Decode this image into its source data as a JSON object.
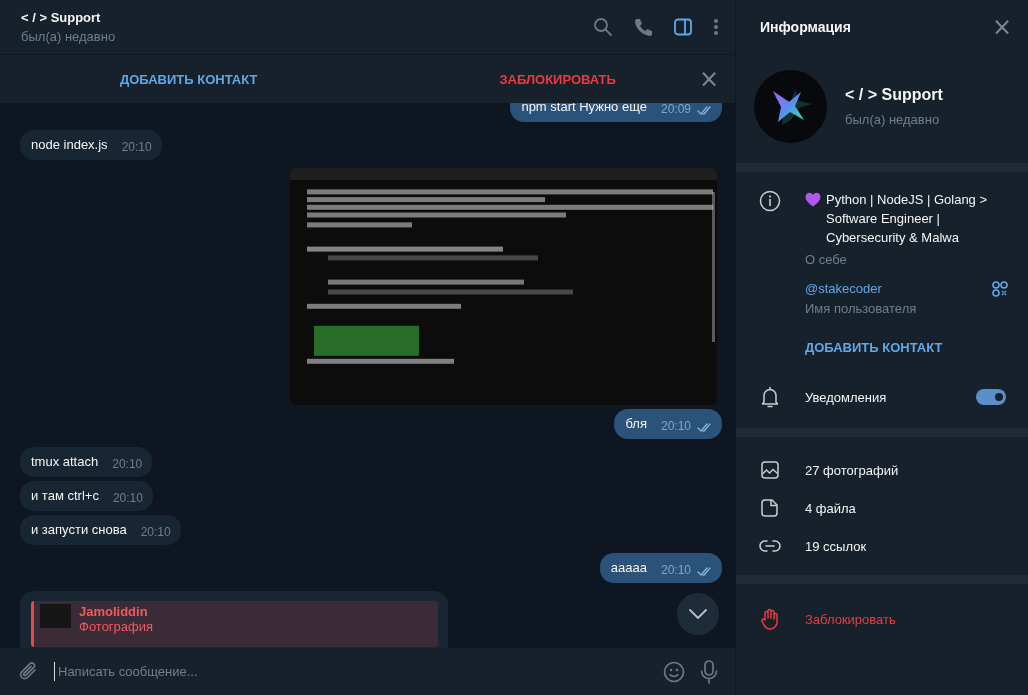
{
  "chat_header": {
    "title": "< / > Support",
    "status": "был(а) недавно",
    "icons": [
      {
        "kind": "search",
        "selected": false
      },
      {
        "kind": "phone",
        "selected": false
      },
      {
        "kind": "sidebar",
        "selected": true
      },
      {
        "kind": "more",
        "selected": false
      }
    ]
  },
  "action_bar": {
    "buttons": [
      {
        "kind": "add",
        "label": "ДОБАВИТЬ КОНТАКТ"
      },
      {
        "kind": "block",
        "label": "ЗАБЛОКИРОВАТЬ"
      }
    ],
    "close": "×"
  },
  "messages": [
    {
      "kind": "text",
      "outgoing": true,
      "text": "npm start Нужно еще",
      "time": "20:09",
      "read": true
    },
    {
      "kind": "text",
      "outgoing": false,
      "text": "node index.js",
      "time": "20:10"
    },
    {
      "kind": "picture",
      "outgoing": true
    },
    {
      "kind": "text",
      "outgoing": true,
      "text": "бля",
      "time": "20:10",
      "read": true
    },
    {
      "kind": "text",
      "outgoing": false,
      "text": "tmux attach",
      "time": "20:10"
    },
    {
      "kind": "text",
      "outgoing": false,
      "text": "и там ctrl+c",
      "time": "20:10"
    },
    {
      "kind": "text",
      "outgoing": false,
      "text": "и запусти снова",
      "time": "20:10"
    },
    {
      "kind": "text",
      "outgoing": true,
      "text": "ааааа",
      "time": "20:10",
      "read": true
    },
    {
      "kind": "reply",
      "outgoing": false,
      "reply": {
        "author": "Jamoliddin",
        "text": "Фотография"
      }
    }
  ],
  "composer": {
    "placeholder": "Написать сообщение..."
  },
  "info_panel": {
    "title": "Информация",
    "close": "×",
    "profile": {
      "name": "< / > Support",
      "status": "был(а) недавно"
    },
    "bio": {
      "text": "Python | NodeJS | Golang > Software Engineer | Cybersecurity & Malwa",
      "label": "О себе"
    },
    "username": {
      "value": "@stakecoder",
      "label": "Имя пользователя"
    },
    "add_contact": "ДОБАВИТЬ КОНТАКТ",
    "notifications": {
      "label": "Уведомления",
      "on": true
    },
    "media": [
      {
        "label": "27 фотографий"
      },
      {
        "kind": "file",
        "label": "4 файла"
      },
      {
        "kind": "link",
        "label": "19 ссылок"
      }
    ],
    "block": "Заблокировать"
  }
}
